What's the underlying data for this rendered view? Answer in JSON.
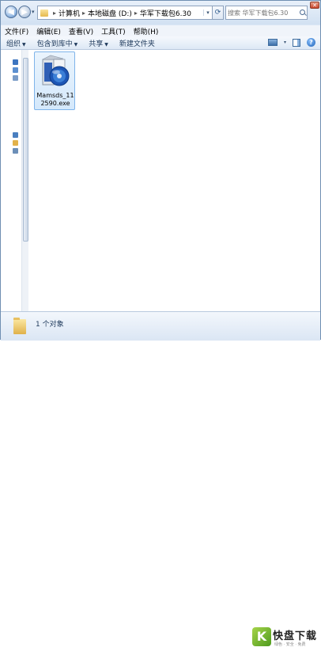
{
  "address": {
    "crumbs": [
      "计算机",
      "本地磁盘 (D:)",
      "华军下载包6.30"
    ]
  },
  "search": {
    "placeholder": "搜索 华军下载包6.30"
  },
  "menu": {
    "items": [
      "文件(F)",
      "编辑(E)",
      "查看(V)",
      "工具(T)",
      "帮助(H)"
    ]
  },
  "toolbar": {
    "organize": "组织",
    "include_in_library": "包含到库中",
    "share": "共享",
    "new_folder": "新建文件夹"
  },
  "files": [
    {
      "name": "Mamsds_112590.exe",
      "icon": "installer-exe-icon"
    }
  ],
  "details": {
    "count": "1 个对象"
  },
  "watermark": {
    "mark": "K",
    "text": "快盘下载",
    "sub": "绿色 · 安全 · 免费"
  },
  "colors": {
    "accent": "#3c6fa8",
    "selection_border": "#7fb4ea",
    "logo_green": "#6bb52c"
  }
}
